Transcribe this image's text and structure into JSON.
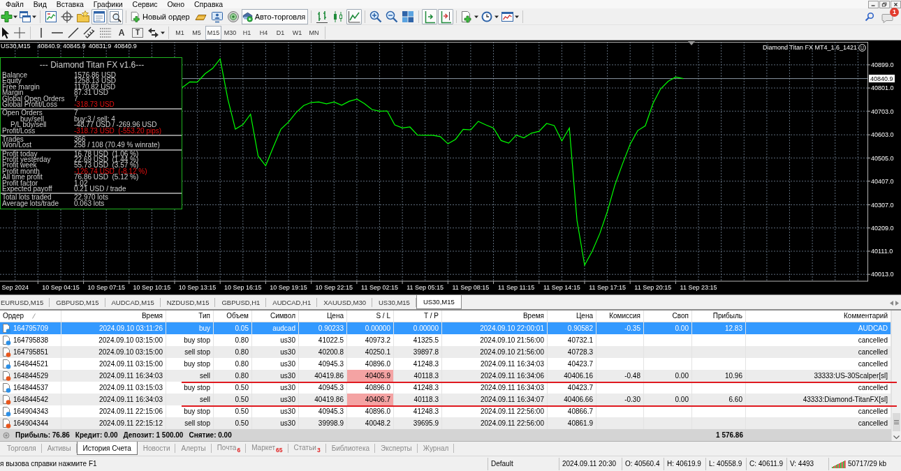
{
  "menu": {
    "items": [
      "Файл",
      "Вид",
      "Вставка",
      "Графики",
      "Сервис",
      "Окно",
      "Справка"
    ]
  },
  "toolbar": {
    "groups": [
      [
        {
          "kind": "icon",
          "pressed": false
        },
        {
          "kind": "icon",
          "pressed": false
        }
      ],
      [
        {
          "kind": "icon",
          "pressed": false
        },
        {
          "kind": "icon",
          "pressed": false
        },
        {
          "kind": "icon",
          "pressed": false
        },
        {
          "kind": "icon",
          "pressed": true
        },
        {
          "kind": "icon",
          "pressed": true
        }
      ],
      [
        {
          "kind": "icon-text",
          "label": "Новый ордер",
          "pressed": false
        },
        {
          "kind": "icon",
          "pressed": false
        },
        {
          "kind": "icon",
          "pressed": false
        },
        {
          "kind": "icon",
          "pressed": false
        },
        {
          "kind": "icon-text",
          "label": "Авто-торговля",
          "pressed": true
        }
      ],
      [
        {
          "kind": "icon",
          "pressed": false
        },
        {
          "kind": "icon",
          "pressed": false
        },
        {
          "kind": "icon",
          "pressed": true
        }
      ],
      [
        {
          "kind": "icon",
          "pressed": false
        },
        {
          "kind": "icon",
          "pressed": false
        },
        {
          "kind": "icon",
          "pressed": false
        }
      ],
      [
        {
          "kind": "icon",
          "pressed": true
        },
        {
          "kind": "icon",
          "pressed": true
        }
      ],
      [
        {
          "kind": "icon",
          "pressed": false
        },
        {
          "kind": "icon",
          "pressed": false
        },
        {
          "kind": "icon",
          "pressed": false
        }
      ]
    ],
    "notification_count": "1"
  },
  "drawing_toolbar": {
    "groups": [
      [
        {
          "kind": "icon"
        },
        {
          "kind": "icon"
        }
      ],
      [
        {
          "kind": "icon"
        },
        {
          "kind": "icon"
        },
        {
          "kind": "icon"
        },
        {
          "kind": "icon"
        },
        {
          "kind": "icon"
        },
        {
          "kind": "text",
          "label": "A"
        },
        {
          "kind": "boxed-text",
          "label": "T"
        },
        {
          "kind": "icon"
        }
      ]
    ],
    "timeframes": [
      {
        "label": "M1",
        "selected": false
      },
      {
        "label": "M5",
        "selected": false
      },
      {
        "label": "M15",
        "selected": true
      },
      {
        "label": "M30",
        "selected": false
      },
      {
        "label": "H1",
        "selected": false
      },
      {
        "label": "H4",
        "selected": false
      },
      {
        "label": "D1",
        "selected": false
      },
      {
        "label": "W1",
        "selected": false
      },
      {
        "label": "MN",
        "selected": false
      }
    ]
  },
  "chart": {
    "symbol": "US30,M15",
    "ohlc": [
      "40840.9",
      "40845.9",
      "40831.9",
      "40840.9"
    ],
    "expert": "Diamond Titan FX MT4_1.6_1421",
    "info_panel": {
      "title": "--- Diamond Titan FX v1.6---",
      "sections": [
        {
          "rows": [
            {
              "kind": "main",
              "label": "Balance",
              "value": "1576.86 USD",
              "alert": false
            },
            {
              "kind": "main",
              "label": "Equity",
              "value": "1258.13 USD",
              "alert": false
            },
            {
              "kind": "main",
              "label": "Free margin",
              "value": "1170.82 USD",
              "alert": false
            },
            {
              "kind": "main",
              "label": "Margin",
              "value": "87.31 USD",
              "alert": false
            },
            {
              "kind": "main",
              "label": "Global Open Orders",
              "value": "7",
              "alert": false
            },
            {
              "kind": "main",
              "label": "Global Profit/Loss",
              "value": "-318.73 USD",
              "alert": true
            }
          ]
        },
        {
          "rows": [
            {
              "kind": "main",
              "label": "Open Orders",
              "value": "7",
              "alert": false
            },
            {
              "kind": "double-indent",
              "label": "buy/sell",
              "value": "buy:3 / sell: 4",
              "alert": false
            },
            {
              "kind": "indent",
              "label": "P/L buy/sell",
              "value": "-48.77 USD / -269.96 USD",
              "alert": false
            },
            {
              "kind": "main",
              "label": "Profit/Loss",
              "value": "-318.73 USD  (-553.20 pips)",
              "alert": true
            }
          ]
        },
        {
          "rows": [
            {
              "kind": "main",
              "label": "Trades",
              "value": "366",
              "alert": false
            },
            {
              "kind": "main",
              "label": "Won/Lost",
              "value": "258 / 108 (70.49 % winrate)",
              "alert": false
            }
          ]
        },
        {
          "rows": [
            {
              "kind": "main",
              "label": "Profit today",
              "value": "16.78 USD  (1.06 %)",
              "alert": false
            },
            {
              "kind": "main",
              "label": "Profit yesterday",
              "value": "22.69 USD  (1.44 %)",
              "alert": false
            },
            {
              "kind": "main",
              "label": "Profit week",
              "value": "55.73 USD  (3.57 %)",
              "alert": false
            },
            {
              "kind": "main",
              "label": "Profit month",
              "value": "-126.74 USD  (-8.12 %)",
              "alert": true
            },
            {
              "kind": "main",
              "label": "All time profit",
              "value": "76.86 USD  (5.12 %)",
              "alert": false
            },
            {
              "kind": "main",
              "label": "Profit factor",
              "value": "1.02",
              "alert": false
            },
            {
              "kind": "main",
              "label": "Expected payoff",
              "value": "0.21 USD / trade",
              "alert": false
            }
          ]
        },
        {
          "rows": [
            {
              "kind": "main",
              "label": "Total lots traded",
              "value": "22.970 lots",
              "alert": false
            },
            {
              "kind": "main",
              "label": "Average lots/trade",
              "value": "0.063 lots",
              "alert": false
            }
          ]
        }
      ]
    },
    "chart_data": [
      {
        "type": "line",
        "categories": [
          null,
          null,
          "Sep 2024",
          null,
          null,
          null,
          null,
          null,
          "10 Sep 04:15",
          null,
          null,
          null,
          null,
          null,
          "10 Sep 07:15",
          null,
          null,
          null,
          null,
          null,
          "10 Sep 10:15",
          null,
          null,
          null,
          null,
          null,
          "10 Sep 13:15",
          null,
          null,
          null,
          null,
          null,
          "10 Sep 16:15",
          null,
          null,
          null,
          null,
          null,
          "10 Sep 19:15",
          null,
          null,
          null,
          null,
          null,
          "10 Sep 22:15",
          null,
          null,
          null,
          null,
          null,
          "11 Sep 02:15",
          null,
          null,
          null,
          null,
          null,
          "11 Sep 05:15",
          null,
          null,
          null,
          null,
          null,
          "11 Sep 08:15",
          null,
          null,
          null,
          null,
          null,
          "11 Sep 11:15",
          null,
          null,
          null,
          null,
          null,
          "11 Sep 14:15",
          null,
          null,
          null,
          null,
          null,
          "11 Sep 17:15",
          null,
          null,
          null,
          null,
          null,
          "11 Sep 20:15",
          null,
          null,
          null,
          null,
          null,
          "11 Sep 23:15",
          null,
          null,
          null,
          null,
          null,
          null,
          null,
          null,
          null,
          null,
          null,
          null,
          null,
          null,
          null,
          null,
          null,
          null,
          null,
          null,
          null,
          null
        ],
        "values": [
          null,
          null,
          null,
          null,
          null,
          null,
          null,
          null,
          null,
          null,
          null,
          null,
          null,
          null,
          null,
          null,
          null,
          null,
          null,
          null,
          null,
          null,
          null,
          null,
          40803,
          40827,
          40826,
          40861,
          40884,
          40924,
          40755,
          40627,
          40646,
          40690,
          40513,
          40472,
          40551,
          40627,
          40657,
          40697,
          40727,
          40740,
          40742,
          40734,
          40742,
          40728,
          40745,
          40754,
          40735,
          40710,
          40703,
          40704,
          40645,
          40632,
          40636,
          40602,
          40601,
          40601,
          40595,
          40565,
          40584,
          40626,
          40624,
          40660,
          40645,
          40632,
          40579,
          40568,
          40602,
          40590,
          40610,
          40618,
          40651,
          40642,
          40577,
          40632,
          40241,
          40052,
          40111,
          40185,
          40279,
          40392,
          40480,
          40563,
          40621,
          40641,
          40735,
          40797,
          40829,
          40847,
          40841,
          null,
          null,
          null,
          null,
          null,
          null,
          null,
          null,
          null,
          null,
          null,
          null,
          null,
          null,
          null,
          null,
          null,
          null,
          null,
          null,
          null,
          null,
          null,
          null
        ],
        "color": "#00ff00",
        "ylim": [
          39984,
          41002
        ],
        "yticks": [
          {
            "value": 40013,
            "label": "40013.0"
          },
          {
            "value": 40111,
            "label": "40111.0"
          },
          {
            "value": 40209,
            "label": "40209.0"
          },
          {
            "value": 40307,
            "label": "40307.0"
          },
          {
            "value": 40407,
            "label": "40407.0"
          },
          {
            "value": 40505,
            "label": "40505.0"
          },
          {
            "value": 40603,
            "label": "40603.0"
          },
          {
            "value": 40703,
            "label": "40703.0"
          },
          {
            "value": 40801,
            "label": "40801.0"
          },
          {
            "value": 40899,
            "label": "40899.0"
          }
        ],
        "grid": true,
        "ref_lines": [
          {
            "axis": "y",
            "value": 40840.9,
            "label": "40840.9",
            "color": "#8a96a3"
          }
        ]
      }
    ]
  },
  "chart_tabs": [
    {
      "label": "EURUSD,M15",
      "selected": false
    },
    {
      "label": "GBPUSD,M15",
      "selected": false
    },
    {
      "label": "AUDCAD,M15",
      "selected": false
    },
    {
      "label": "NZDUSD,M15",
      "selected": false
    },
    {
      "label": "GBPUSD,H1",
      "selected": false
    },
    {
      "label": "AUDCAD,H1",
      "selected": false
    },
    {
      "label": "XAUUSD,M30",
      "selected": false
    },
    {
      "label": "US30,M15",
      "selected": false
    },
    {
      "label": "US30,M15",
      "selected": true
    }
  ],
  "history": {
    "columns": [
      {
        "label": "Ордер",
        "sorted": true
      },
      {
        "label": "Время",
        "sorted": false
      },
      {
        "label": "Тип",
        "sorted": false
      },
      {
        "label": "Объем",
        "sorted": false
      },
      {
        "label": "Символ",
        "sorted": false
      },
      {
        "label": "Цена",
        "sorted": false
      },
      {
        "label": "S / L",
        "sorted": false
      },
      {
        "label": "T / P",
        "sorted": false
      },
      {
        "label": "Время",
        "sorted": false
      },
      {
        "label": "Цена",
        "sorted": false
      },
      {
        "label": "Комиссия",
        "sorted": false
      },
      {
        "label": "Своп",
        "sorted": false
      },
      {
        "label": "Прибыль",
        "sorted": false
      },
      {
        "label": "Комментарий",
        "sorted": false
      }
    ],
    "rows": [
      {
        "kind": "buy",
        "selected": true,
        "sl_hit": false,
        "underlined": false,
        "order": "164795709",
        "open_time": "2024.09.10 03:11:26",
        "type": "buy",
        "volume": "0.05",
        "symbol": "audcad",
        "open_price": "0.90233",
        "sl": "0.00000",
        "tp": "0.00000",
        "close_time": "2024.09.10 22:00:01",
        "close_price": "0.90582",
        "commission": "-0.35",
        "swap": "0.00",
        "profit": "12.83",
        "comment": "AUDCAD"
      },
      {
        "kind": "buy",
        "selected": false,
        "sl_hit": false,
        "underlined": false,
        "order": "164795838",
        "open_time": "2024.09.10 03:15:00",
        "type": "buy stop",
        "volume": "0.80",
        "symbol": "us30",
        "open_price": "41022.5",
        "sl": "40973.2",
        "tp": "41325.5",
        "close_time": "2024.09.10 21:56:00",
        "close_price": "40732.1",
        "comment": "cancelled"
      },
      {
        "kind": "sell",
        "selected": false,
        "sl_hit": false,
        "underlined": false,
        "order": "164795851",
        "open_time": "2024.09.10 03:15:00",
        "type": "sell stop",
        "volume": "0.80",
        "symbol": "us30",
        "open_price": "40200.8",
        "sl": "40250.1",
        "tp": "39897.8",
        "close_time": "2024.09.10 21:56:00",
        "close_price": "40728.3",
        "comment": "cancelled"
      },
      {
        "kind": "buy",
        "selected": false,
        "sl_hit": false,
        "underlined": false,
        "order": "164844521",
        "open_time": "2024.09.11 03:15:00",
        "type": "buy stop",
        "volume": "0.80",
        "symbol": "us30",
        "open_price": "40945.3",
        "sl": "40896.0",
        "tp": "41248.3",
        "close_time": "2024.09.11 16:34:03",
        "close_price": "40423.7",
        "comment": "cancelled"
      },
      {
        "kind": "sell",
        "selected": false,
        "sl_hit": true,
        "underlined": true,
        "order": "164844529",
        "open_time": "2024.09.11 16:34:03",
        "type": "sell",
        "volume": "0.80",
        "symbol": "us30",
        "open_price": "40419.86",
        "sl": "40405.9",
        "tp": "40118.3",
        "close_time": "2024.09.11 16:34:06",
        "close_price": "40406.16",
        "commission": "-0.48",
        "swap": "0.00",
        "profit": "10.96",
        "comment": "33333:US-30Scalper[sl]"
      },
      {
        "kind": "buy",
        "selected": false,
        "sl_hit": false,
        "underlined": false,
        "order": "164844537",
        "open_time": "2024.09.11 03:15:03",
        "type": "buy stop",
        "volume": "0.50",
        "symbol": "us30",
        "open_price": "40945.3",
        "sl": "40896.0",
        "tp": "41248.3",
        "close_time": "2024.09.11 16:34:03",
        "close_price": "40423.7",
        "comment": "cancelled"
      },
      {
        "kind": "sell",
        "selected": false,
        "sl_hit": true,
        "underlined": true,
        "order": "164844542",
        "open_time": "2024.09.11 16:34:03",
        "type": "sell",
        "volume": "0.50",
        "symbol": "us30",
        "open_price": "40419.86",
        "sl": "40406.7",
        "tp": "40118.3",
        "close_time": "2024.09.11 16:34:07",
        "close_price": "40406.66",
        "commission": "-0.30",
        "swap": "0.00",
        "profit": "6.60",
        "comment": "43333:Diamond-TitanFX[sl]"
      },
      {
        "kind": "buy",
        "selected": false,
        "sl_hit": false,
        "underlined": false,
        "order": "164904343",
        "open_time": "2024.09.11 22:15:06",
        "type": "buy stop",
        "volume": "0.50",
        "symbol": "us30",
        "open_price": "40945.3",
        "sl": "40896.0",
        "tp": "41248.3",
        "close_time": "2024.09.11 22:56:00",
        "close_price": "40866.7",
        "comment": "cancelled"
      },
      {
        "kind": "sell",
        "selected": false,
        "sl_hit": false,
        "underlined": false,
        "order": "164904344",
        "open_time": "2024.09.11 22:15:12",
        "type": "sell stop",
        "volume": "0.50",
        "symbol": "us30",
        "open_price": "39998.9",
        "sl": "40048.2",
        "tp": "39695.9",
        "close_time": "2024.09.11 22:56:00",
        "close_price": "40861.9",
        "comment": "cancelled"
      }
    ],
    "summary": {
      "items": [
        "Прибыль: 76.86",
        "Кредит: 0.00",
        "Депозит: 1 500.00",
        "Снятие: 0.00"
      ],
      "total": "1 576.86"
    }
  },
  "terminal_tabs": [
    {
      "label": "Торговля",
      "selected": false
    },
    {
      "label": "Активы",
      "selected": false
    },
    {
      "label": "История Счета",
      "selected": true
    },
    {
      "label": "Новости",
      "selected": false
    },
    {
      "label": "Алерты",
      "selected": false
    },
    {
      "label": "Почта",
      "badge": "6",
      "selected": false
    },
    {
      "label": "Маркет",
      "badge": "65",
      "selected": false
    },
    {
      "label": "Статьи",
      "badge": "3",
      "selected": false
    },
    {
      "label": "Библиотека",
      "selected": false
    },
    {
      "label": "Эксперты",
      "selected": false
    },
    {
      "label": "Журнал",
      "selected": false
    }
  ],
  "status_bar": {
    "hint": "я вызова справки нажмите F1",
    "profile": "Default",
    "time": "2024.09.11 20:30",
    "open": "O: 40560.4",
    "high": "H: 40619.9",
    "low": "L: 40558.9",
    "close": "C: 40611.9",
    "volume": "V: 4493",
    "traffic": "50717/29 kb"
  }
}
